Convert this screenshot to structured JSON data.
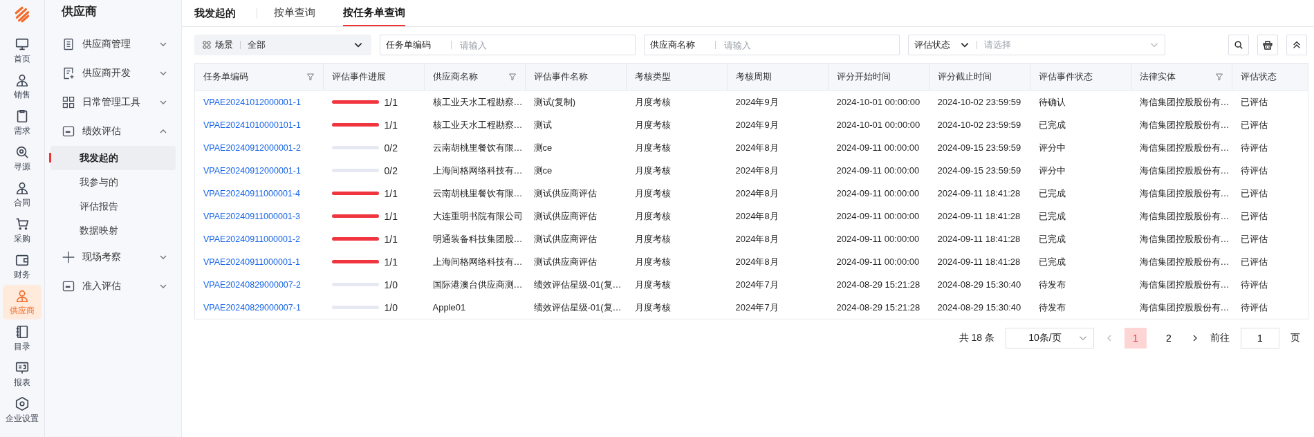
{
  "rail": [
    {
      "kind": "monitor",
      "label": "首页",
      "selected": false
    },
    {
      "kind": "person",
      "label": "销售",
      "selected": false
    },
    {
      "kind": "clipboard",
      "label": "需求",
      "selected": false
    },
    {
      "kind": "search",
      "label": "寻源",
      "selected": false
    },
    {
      "kind": "person",
      "label": "合同",
      "selected": false
    },
    {
      "kind": "cart",
      "label": "采购",
      "selected": false
    },
    {
      "kind": "wallet",
      "label": "财务",
      "selected": false
    },
    {
      "kind": "person",
      "label": "供应商",
      "selected": true
    },
    {
      "kind": "book",
      "label": "目录",
      "selected": false
    },
    {
      "kind": "board",
      "label": "报表",
      "selected": false
    },
    {
      "kind": "hexagon",
      "label": "企业设置",
      "selected": false
    }
  ],
  "sidebar": {
    "title": "供应商",
    "groups": [
      {
        "kind": "doc",
        "label": "供应商管理",
        "expanded": false
      },
      {
        "kind": "docplus",
        "label": "供应商开发",
        "expanded": false
      },
      {
        "kind": "grid",
        "label": "日常管理工具",
        "expanded": false
      },
      {
        "kind": "card",
        "label": "绩效评估",
        "expanded": true,
        "children": [
          {
            "label": "我发起的",
            "selected": true
          },
          {
            "label": "我参与的",
            "selected": false
          },
          {
            "label": "评估报告",
            "selected": false
          },
          {
            "label": "数据映射",
            "selected": false
          }
        ]
      },
      {
        "kind": "plus",
        "label": "现场考察",
        "expanded": false
      },
      {
        "kind": "card",
        "label": "准入评估",
        "expanded": false
      }
    ]
  },
  "page_title": "我发起的",
  "tabs": [
    {
      "label": "按单查询",
      "selected": false
    },
    {
      "label": "按任务单查询",
      "selected": true
    }
  ],
  "filters": {
    "scene_label": "场景",
    "scene_value": "全部",
    "fields": [
      {
        "label": "任务单编码",
        "placeholder": "请输入"
      },
      {
        "label": "供应商名称",
        "placeholder": "请输入"
      }
    ],
    "status_label": "评估状态",
    "status_placeholder": "请选择"
  },
  "table": {
    "columns": [
      {
        "label": "任务单编码",
        "filter": true
      },
      {
        "label": "评估事件进展",
        "filter": false
      },
      {
        "label": "供应商名称",
        "filter": true
      },
      {
        "label": "评估事件名称",
        "filter": false
      },
      {
        "label": "考核类型",
        "filter": false
      },
      {
        "label": "考核周期",
        "filter": false
      },
      {
        "label": "评分开始时间",
        "filter": false
      },
      {
        "label": "评分截止时间",
        "filter": false
      },
      {
        "label": "评估事件状态",
        "filter": false
      },
      {
        "label": "法律实体",
        "filter": true
      },
      {
        "label": "评估状态",
        "filter": false
      }
    ],
    "rows": [
      {
        "code": "VPAE20241012000001-1",
        "level": 1,
        "progress": "1/1",
        "supplier": "核工业天水工程勘察…",
        "event": "测试(复制)",
        "type": "月度考核",
        "period": "2024年9月",
        "start": "2024-10-01 00:00:00",
        "end": "2024-10-02 23:59:59",
        "event_status": "待确认",
        "entity": "海信集团控股股份有…",
        "status": "已评估"
      },
      {
        "code": "VPAE20241010000101-1",
        "level": 1,
        "progress": "1/1",
        "supplier": "核工业天水工程勘察…",
        "event": "测试",
        "type": "月度考核",
        "period": "2024年9月",
        "start": "2024-10-01 00:00:00",
        "end": "2024-10-02 23:59:59",
        "event_status": "已完成",
        "entity": "海信集团控股股份有…",
        "status": "已评估"
      },
      {
        "code": "VPAE20240912000001-2",
        "level": 0,
        "progress": "0/2",
        "supplier": "云南胡桃里餐饮有限…",
        "event": "测ce",
        "type": "月度考核",
        "period": "2024年8月",
        "start": "2024-09-11 00:00:00",
        "end": "2024-09-15 23:59:59",
        "event_status": "评分中",
        "entity": "海信集团控股股份有…",
        "status": "待评估"
      },
      {
        "code": "VPAE20240912000001-1",
        "level": 0,
        "progress": "0/2",
        "supplier": "上海间格网络科技有…",
        "event": "测ce",
        "type": "月度考核",
        "period": "2024年8月",
        "start": "2024-09-11 00:00:00",
        "end": "2024-09-15 23:59:59",
        "event_status": "评分中",
        "entity": "海信集团控股股份有…",
        "status": "待评估"
      },
      {
        "code": "VPAE20240911000001-4",
        "level": 1,
        "progress": "1/1",
        "supplier": "云南胡桃里餐饮有限…",
        "event": "测试供应商评估",
        "type": "月度考核",
        "period": "2024年8月",
        "start": "2024-09-11 00:00:00",
        "end": "2024-09-11 18:41:28",
        "event_status": "已完成",
        "entity": "海信集团控股股份有…",
        "status": "已评估"
      },
      {
        "code": "VPAE20240911000001-3",
        "level": 1,
        "progress": "1/1",
        "supplier": "大连重明书院有限公司",
        "event": "测试供应商评估",
        "type": "月度考核",
        "period": "2024年8月",
        "start": "2024-09-11 00:00:00",
        "end": "2024-09-11 18:41:28",
        "event_status": "已完成",
        "entity": "海信集团控股股份有…",
        "status": "已评估"
      },
      {
        "code": "VPAE20240911000001-2",
        "level": 1,
        "progress": "1/1",
        "supplier": "明通装备科技集团股…",
        "event": "测试供应商评估",
        "type": "月度考核",
        "period": "2024年8月",
        "start": "2024-09-11 00:00:00",
        "end": "2024-09-11 18:41:28",
        "event_status": "已完成",
        "entity": "海信集团控股股份有…",
        "status": "已评估"
      },
      {
        "code": "VPAE20240911000001-1",
        "level": 1,
        "progress": "1/1",
        "supplier": "上海间格网络科技有…",
        "event": "测试供应商评估",
        "type": "月度考核",
        "period": "2024年8月",
        "start": "2024-09-11 00:00:00",
        "end": "2024-09-11 18:41:28",
        "event_status": "已完成",
        "entity": "海信集团控股股份有…",
        "status": "已评估"
      },
      {
        "code": "VPAE20240829000007-2",
        "level": 0,
        "progress": "1/0",
        "supplier": "国际港澳台供应商测…",
        "event": "绩效评估星级-01(复…",
        "type": "月度考核",
        "period": "2024年7月",
        "start": "2024-08-29 15:21:28",
        "end": "2024-08-29 15:30:40",
        "event_status": "待发布",
        "entity": "海信集团控股股份有…",
        "status": "待评估"
      },
      {
        "code": "VPAE20240829000007-1",
        "level": 0,
        "progress": "1/0",
        "supplier": "Apple01",
        "event": "绩效评估星级-01(复…",
        "type": "月度考核",
        "period": "2024年7月",
        "start": "2024-08-29 15:21:28",
        "end": "2024-08-29 15:30:40",
        "event_status": "待发布",
        "entity": "海信集团控股股份有…",
        "status": "待评估"
      }
    ]
  },
  "pagination": {
    "total": "共 18 条",
    "page_size": "10条/页",
    "pages": [
      {
        "label": "1",
        "selected": true
      },
      {
        "label": "2",
        "selected": false
      }
    ],
    "goto_label": "前往",
    "goto_value": "1",
    "goto_suffix": "页"
  }
}
